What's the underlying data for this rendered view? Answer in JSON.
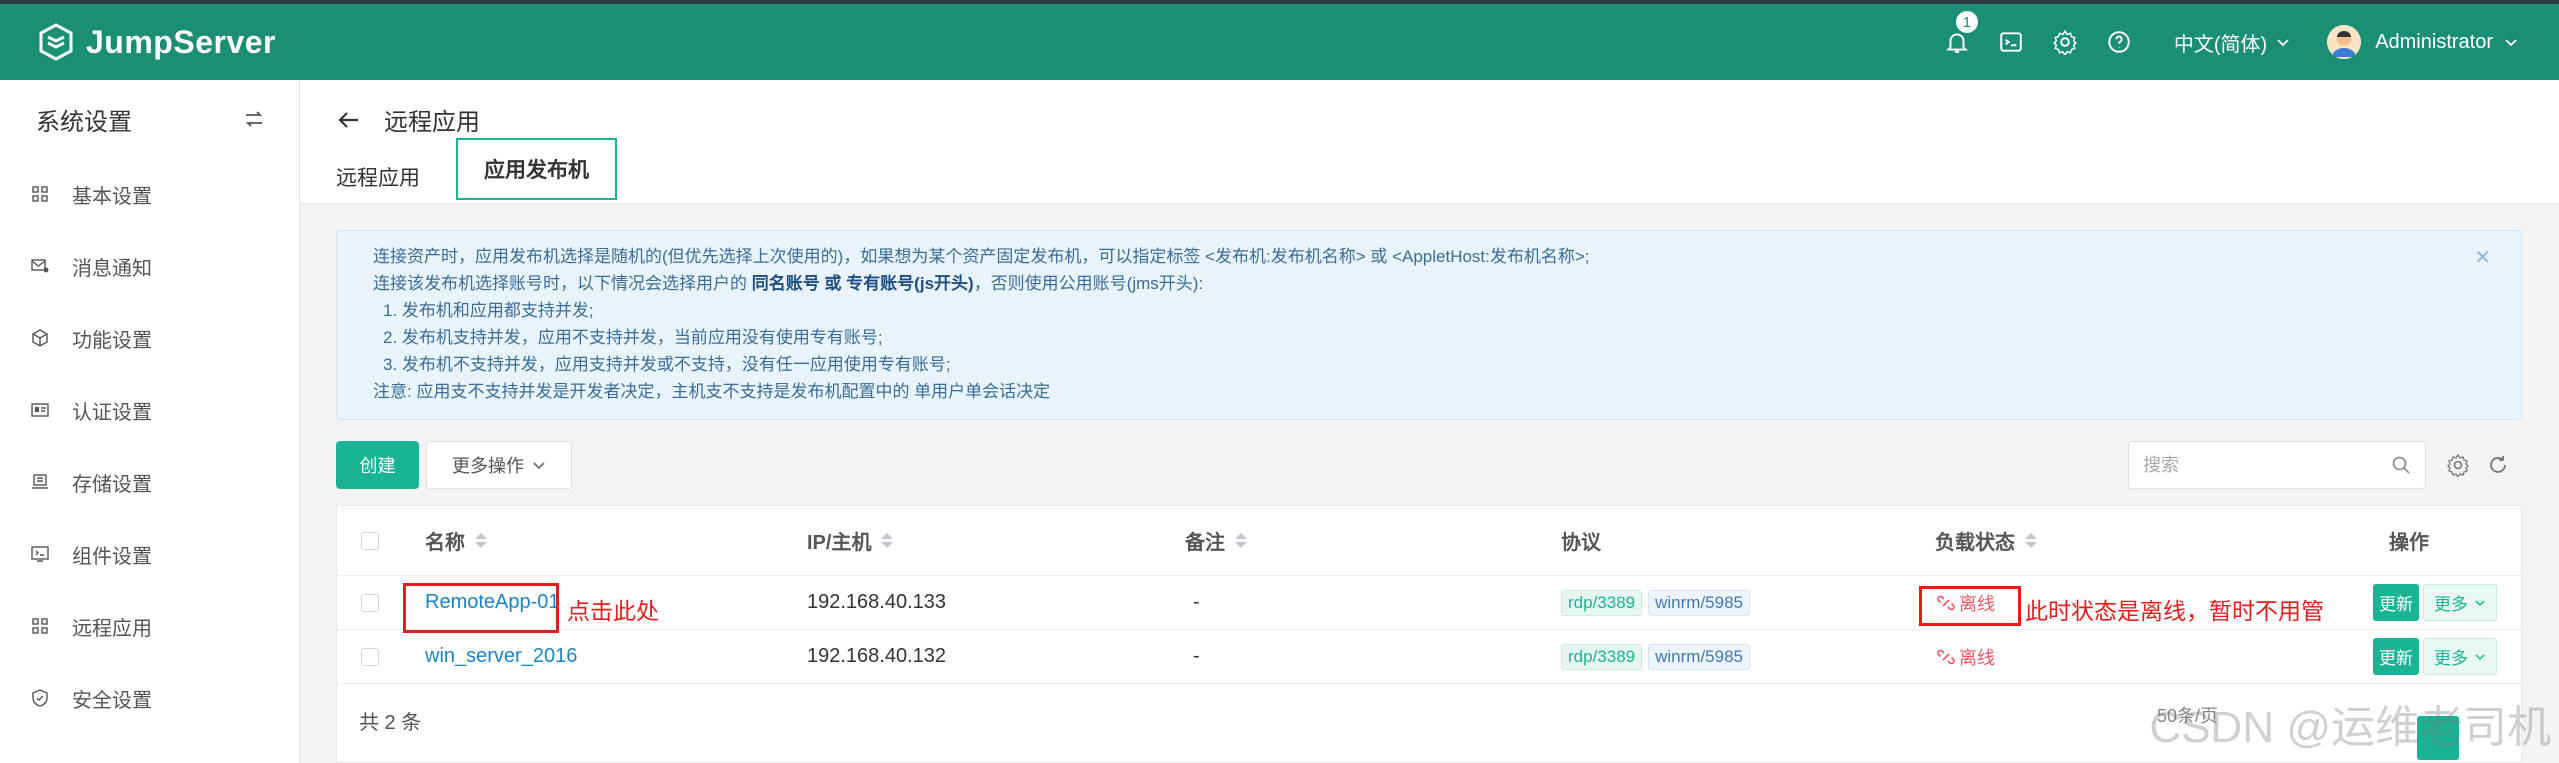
{
  "app": {
    "name": "JumpServer"
  },
  "topbar": {
    "notification_count": "1",
    "language": "中文(简体)",
    "user": "Administrator"
  },
  "sidebar": {
    "title": "系统设置",
    "items": [
      {
        "label": "基本设置",
        "icon": "grid-icon"
      },
      {
        "label": "消息通知",
        "icon": "message-icon"
      },
      {
        "label": "功能设置",
        "icon": "cube-icon"
      },
      {
        "label": "认证设置",
        "icon": "id-card-icon"
      },
      {
        "label": "存储设置",
        "icon": "storage-icon"
      },
      {
        "label": "组件设置",
        "icon": "component-icon"
      },
      {
        "label": "远程应用",
        "icon": "remote-app-icon"
      },
      {
        "label": "安全设置",
        "icon": "shield-icon"
      }
    ]
  },
  "page": {
    "title": "远程应用",
    "tabs": [
      {
        "label": "远程应用"
      },
      {
        "label": "应用发布机"
      }
    ]
  },
  "info": {
    "line1": "连接资产时，应用发布机选择是随机的(但优先选择上次使用的)，如果想为某个资产固定发布机，可以指定标签 <发布机:发布机名称> 或 <AppletHost:发布机名称>;",
    "line2_prefix": "连接该发布机选择账号时，以下情况会选择用户的 ",
    "line2_bold": "同名账号 或 专有账号(js开头)",
    "line2_suffix": "，否则使用公用账号(jms开头):",
    "item1": "1. 发布机和应用都支持并发;",
    "item2": "2. 发布机支持并发，应用不支持并发，当前应用没有使用专有账号;",
    "item3": "3. 发布机不支持并发，应用支持并发或不支持，没有任一应用使用专有账号;",
    "note": "注意: 应用支不支持并发是开发者决定，主机支不支持是发布机配置中的 单用户单会话决定"
  },
  "toolbar": {
    "create_label": "创建",
    "more_label": "更多操作",
    "search_placeholder": "搜索"
  },
  "table": {
    "columns": [
      "名称",
      "IP/主机",
      "备注",
      "协议",
      "负载状态",
      "操作"
    ],
    "rows": [
      {
        "name": "RemoteApp-01",
        "ip": "192.168.40.133",
        "comment": "-",
        "protocols": [
          "rdp/3389",
          "winrm/5985"
        ],
        "status": "离线",
        "update": "更新",
        "more": "更多"
      },
      {
        "name": "win_server_2016",
        "ip": "192.168.40.132",
        "comment": "-",
        "protocols": [
          "rdp/3389",
          "winrm/5985"
        ],
        "status": "离线",
        "update": "更新",
        "more": "更多"
      }
    ],
    "total": "共 2 条",
    "page_size": "50条/页"
  },
  "annotations": {
    "click_here": "点击此处",
    "status_note": "此时状态是离线，暂时不用管"
  },
  "watermark": "CSDN @运维老司机",
  "colors": {
    "brand": "#1a8f74",
    "primary": "#1ab394",
    "link": "#1c84c6",
    "danger": "#ed5565",
    "annotation": "#e31c1c"
  }
}
